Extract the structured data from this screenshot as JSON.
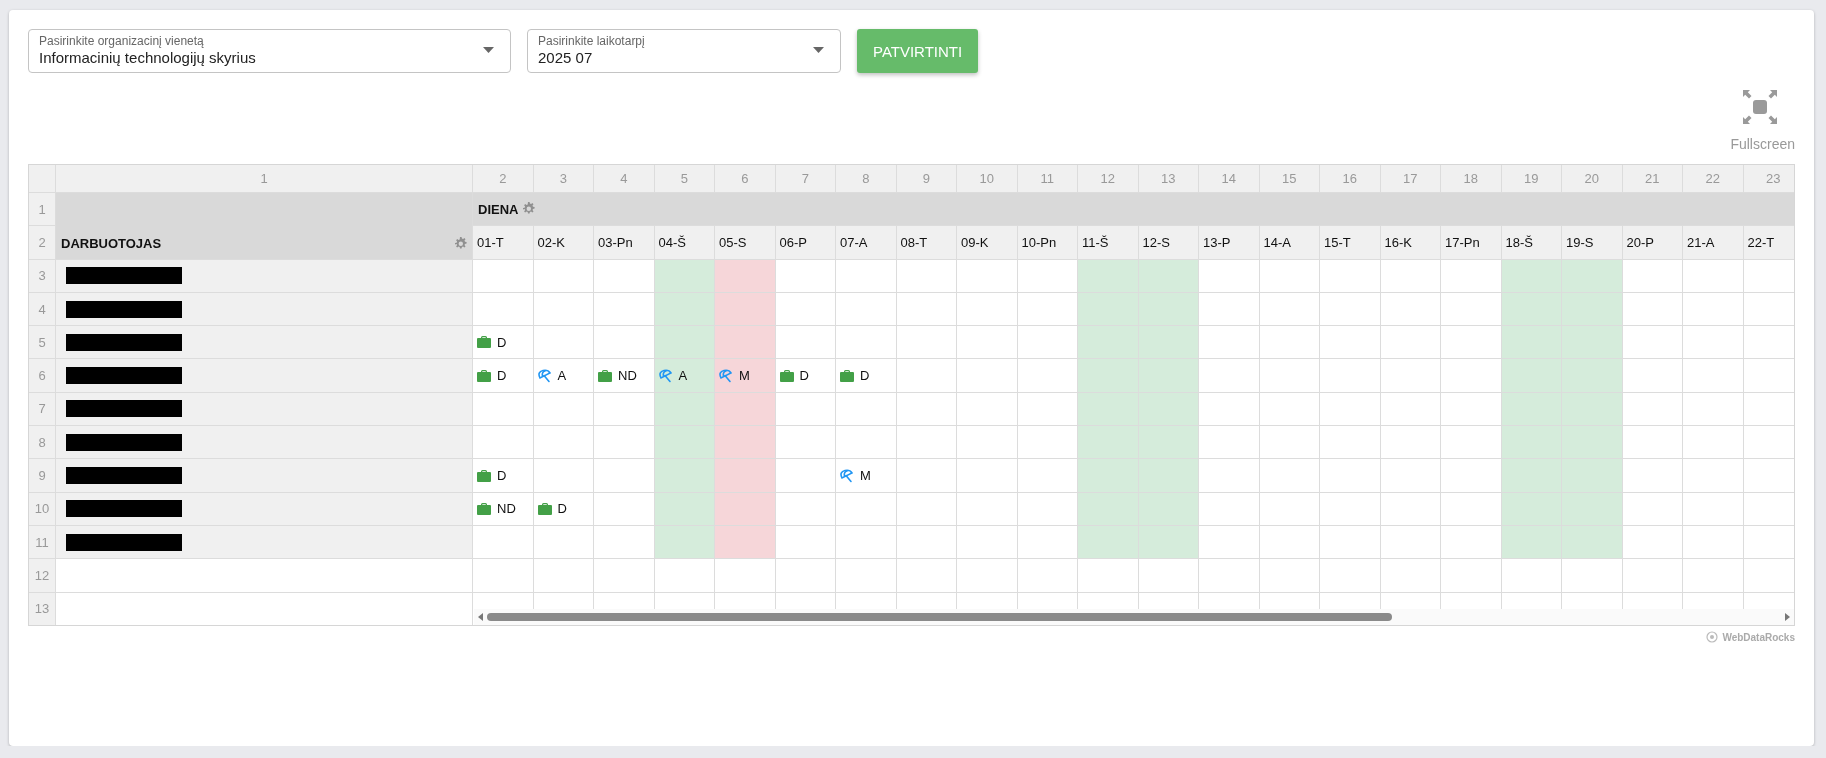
{
  "filters": [
    {
      "label": "Pasirinkite organizacinį vienetą",
      "value": "Informacinių technologijų skyrius"
    },
    {
      "label": "Pasirinkite laikotarpį",
      "value": "2025 07"
    }
  ],
  "confirm_button": "PATVIRTINTI",
  "fullscreen": {
    "label": "Fullscreen"
  },
  "pivot": {
    "column_numbers": [
      "1",
      "2",
      "3",
      "4",
      "5",
      "6",
      "7",
      "8",
      "9",
      "10",
      "11",
      "12",
      "13",
      "14",
      "15",
      "16",
      "17",
      "18",
      "19",
      "20",
      "21",
      "22",
      "23"
    ],
    "row_numbers": [
      "1",
      "2",
      "3",
      "4",
      "5",
      "6",
      "7",
      "8",
      "9",
      "10",
      "11",
      "12",
      "13"
    ],
    "column_header": "DIENA",
    "row_header": "DARBUOTOJAS",
    "days": [
      {
        "label": "01-T",
        "kind": "workday"
      },
      {
        "label": "02-K",
        "kind": "workday"
      },
      {
        "label": "03-Pn",
        "kind": "workday"
      },
      {
        "label": "04-Š",
        "kind": "weekend"
      },
      {
        "label": "05-S",
        "kind": "holiday"
      },
      {
        "label": "06-P",
        "kind": "workday"
      },
      {
        "label": "07-A",
        "kind": "workday"
      },
      {
        "label": "08-T",
        "kind": "workday"
      },
      {
        "label": "09-K",
        "kind": "workday"
      },
      {
        "label": "10-Pn",
        "kind": "workday"
      },
      {
        "label": "11-Š",
        "kind": "weekend"
      },
      {
        "label": "12-S",
        "kind": "weekend"
      },
      {
        "label": "13-P",
        "kind": "workday"
      },
      {
        "label": "14-A",
        "kind": "workday"
      },
      {
        "label": "15-T",
        "kind": "workday"
      },
      {
        "label": "16-K",
        "kind": "workday"
      },
      {
        "label": "17-Pn",
        "kind": "workday"
      },
      {
        "label": "18-Š",
        "kind": "weekend"
      },
      {
        "label": "19-S",
        "kind": "weekend"
      },
      {
        "label": "20-P",
        "kind": "workday"
      },
      {
        "label": "21-A",
        "kind": "workday"
      },
      {
        "label": "22-T",
        "kind": "workday"
      }
    ],
    "employees": [
      {
        "name_redacted": true
      },
      {
        "name_redacted": true
      },
      {
        "name_redacted": true,
        "cells": [
          {
            "kind": "briefcase",
            "code": "D"
          }
        ]
      },
      {
        "name_redacted": true,
        "cells": [
          {
            "kind": "briefcase",
            "code": "D"
          },
          {
            "kind": "umbrella",
            "code": "A"
          },
          {
            "kind": "briefcase",
            "code": "ND"
          },
          {
            "kind": "umbrella",
            "code": "A"
          },
          {
            "kind": "umbrella",
            "code": "M"
          },
          {
            "kind": "briefcase",
            "code": "D"
          },
          {
            "kind": "briefcase",
            "code": "D"
          }
        ]
      },
      {
        "name_redacted": true
      },
      {
        "name_redacted": true
      },
      {
        "name_redacted": true,
        "cells": [
          {
            "kind": "briefcase",
            "code": "D"
          },
          {
            "kind": "blank"
          },
          {
            "kind": "blank"
          },
          {
            "kind": "blank"
          },
          {
            "kind": "blank"
          },
          {
            "kind": "blank"
          },
          {
            "kind": "umbrella",
            "code": "M"
          }
        ]
      },
      {
        "name_redacted": true,
        "cells": [
          {
            "kind": "briefcase",
            "code": "ND"
          },
          {
            "kind": "briefcase",
            "code": "D"
          }
        ]
      },
      {
        "name_redacted": true
      }
    ]
  },
  "credit": "WebDataRocks"
}
